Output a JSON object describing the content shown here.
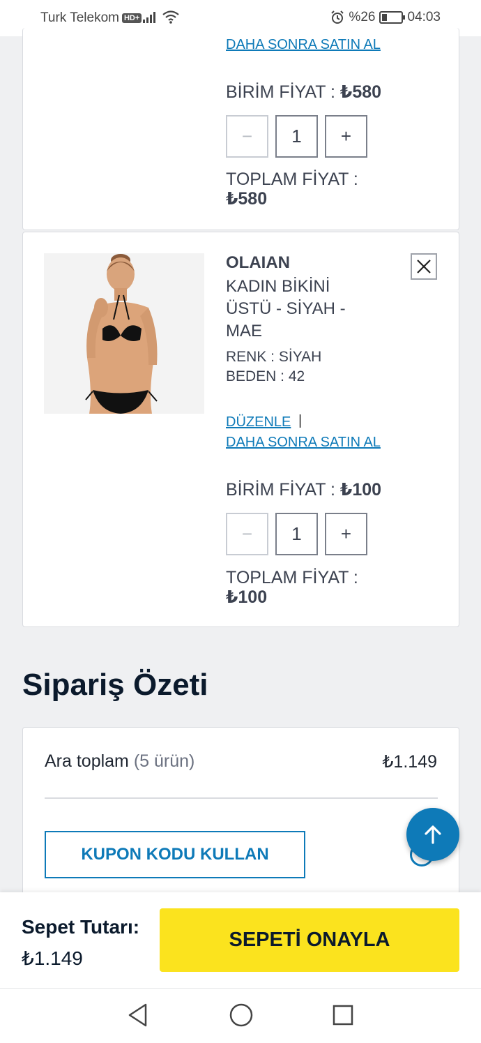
{
  "status_bar": {
    "carrier": "Turk Telekom",
    "hd": "HD+",
    "battery": "%26",
    "time": "04:03",
    "battery_level": 0.26
  },
  "item1": {
    "buy_later": "DAHA SONRA SATIN AL",
    "unit_price_label": "BİRİM FİYAT :",
    "unit_price": "₺580",
    "qty_minus": "−",
    "quantity": "1",
    "qty_plus": "+",
    "total_label": "TOPLAM FİYAT :",
    "total_value": "₺580"
  },
  "item2": {
    "brand": "OLAIAN",
    "name": "KADIN BİKİNİ ÜSTÜ - SİYAH - MAE",
    "color": "RENK : SİYAH",
    "size": "BEDEN : 42",
    "edit": "DÜZENLE",
    "separator": "|",
    "buy_later": "DAHA SONRA SATIN AL",
    "unit_price_label": "BİRİM FİYAT :",
    "unit_price": "₺100",
    "qty_minus": "−",
    "quantity": "1",
    "qty_plus": "+",
    "total_label": "TOPLAM FİYAT :",
    "total_value": "₺100",
    "image_icon": "bikini-product-photo"
  },
  "summary": {
    "title": "Sipariş Özeti",
    "subtotal_label": "Ara toplam",
    "subtotal_count": "(5 ürün)",
    "subtotal_value": "₺1.149",
    "coupon_button": "KUPON KODU KULLAN"
  },
  "bottom_bar": {
    "basket_label": "Sepet Tutarı:",
    "basket_value": "₺1.149",
    "confirm_button": "SEPETİ ONAYLA"
  },
  "colors": {
    "accent": "#0e7ab8",
    "confirm": "#fbe31e",
    "text": "#3c4250",
    "background": "#eff0f2"
  }
}
